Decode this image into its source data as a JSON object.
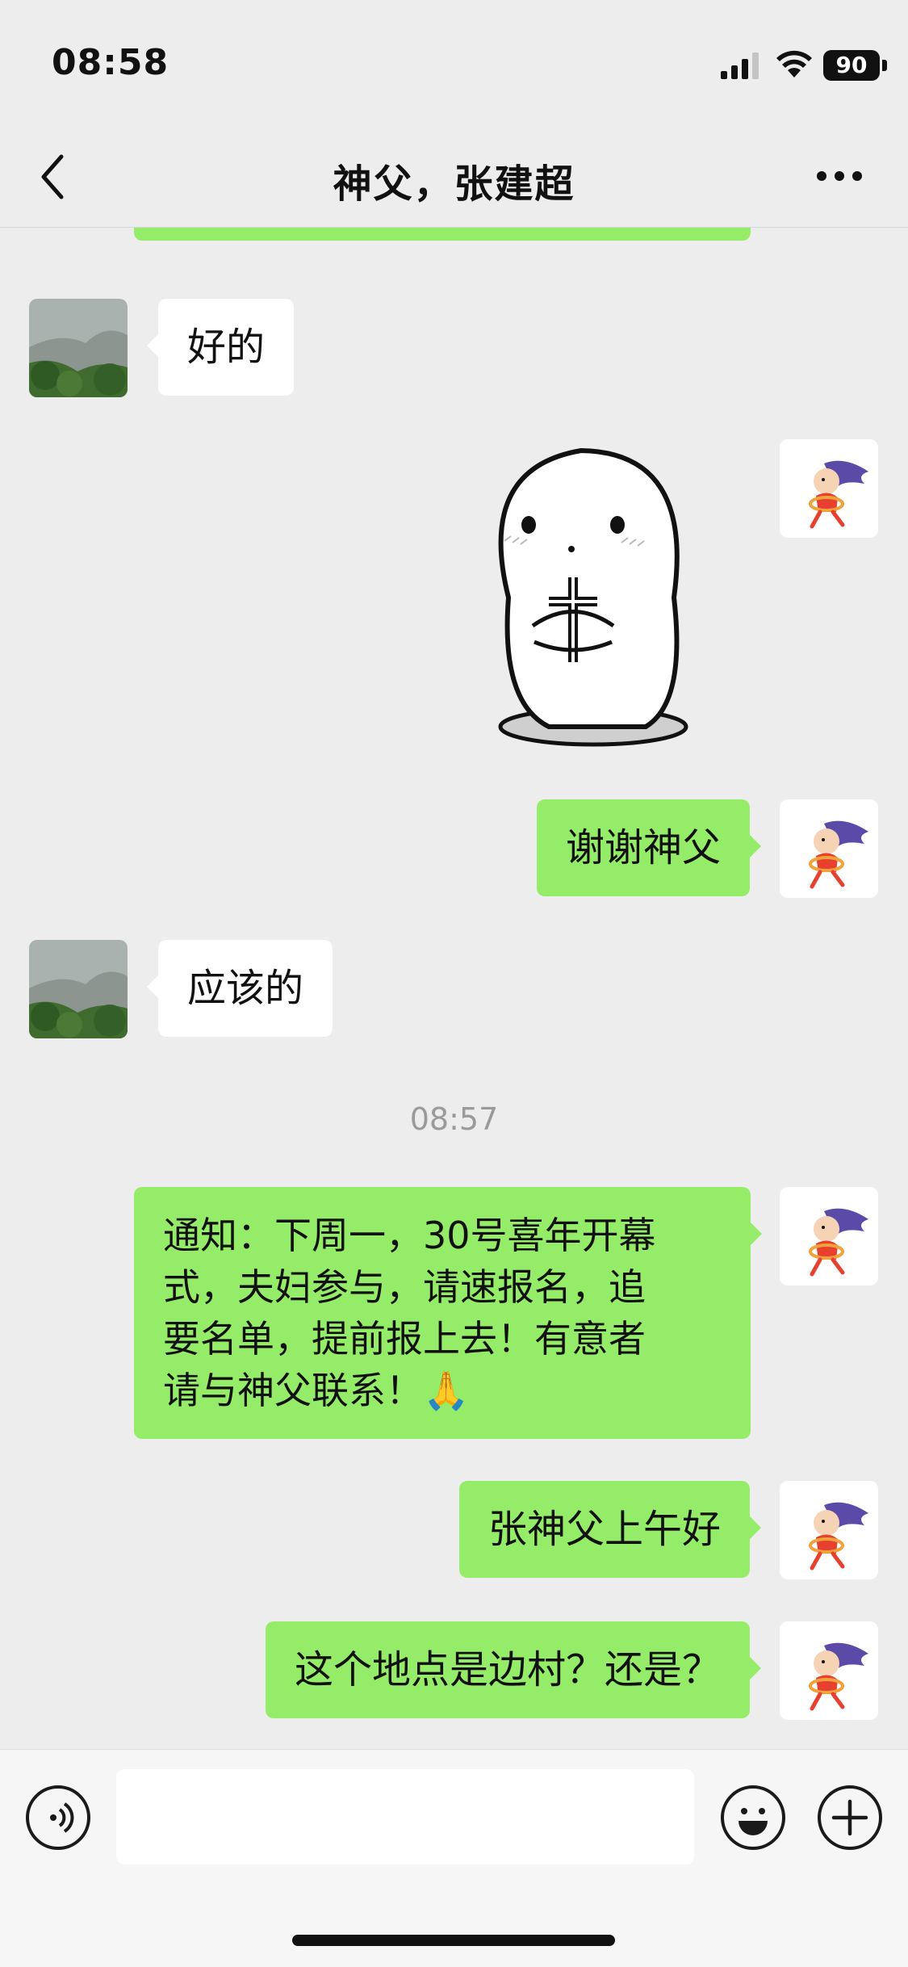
{
  "status_bar": {
    "time": "08:58",
    "battery": "90"
  },
  "nav": {
    "title": "神父，张建超",
    "back_icon": "chevron-left-icon",
    "more_icon": "ellipsis-icon"
  },
  "messages": [
    {
      "side": "in",
      "text": "好的"
    },
    {
      "side": "out",
      "type": "sticker",
      "sticker": "praying-blob-with-cross"
    },
    {
      "side": "out",
      "text": "谢谢神父"
    },
    {
      "side": "in",
      "text": "应该的"
    },
    {
      "type": "time",
      "text": "08:57"
    },
    {
      "side": "out",
      "text": "通知：下周一，30号喜年开幕式，夫妇参与，请速报名，追要名单，提前报上去！有意者请与神父联系！🙏",
      "lines": [
        "通知：下周一，30号喜年开幕",
        "式，夫妇参与，请速报名，追",
        "要名单，提前报上去！有意者",
        "请与神父联系！🙏"
      ]
    },
    {
      "side": "out",
      "text": "张神父上午好"
    },
    {
      "side": "out",
      "text": "这个地点是边村？还是？"
    }
  ],
  "input_bar": {
    "placeholder": "",
    "voice_icon": "voice-icon",
    "emoji_icon": "emoji-icon",
    "plus_icon": "plus-icon"
  },
  "colors": {
    "bg": "#ededed",
    "outgoing": "#95ec69",
    "incoming": "#ffffff"
  }
}
